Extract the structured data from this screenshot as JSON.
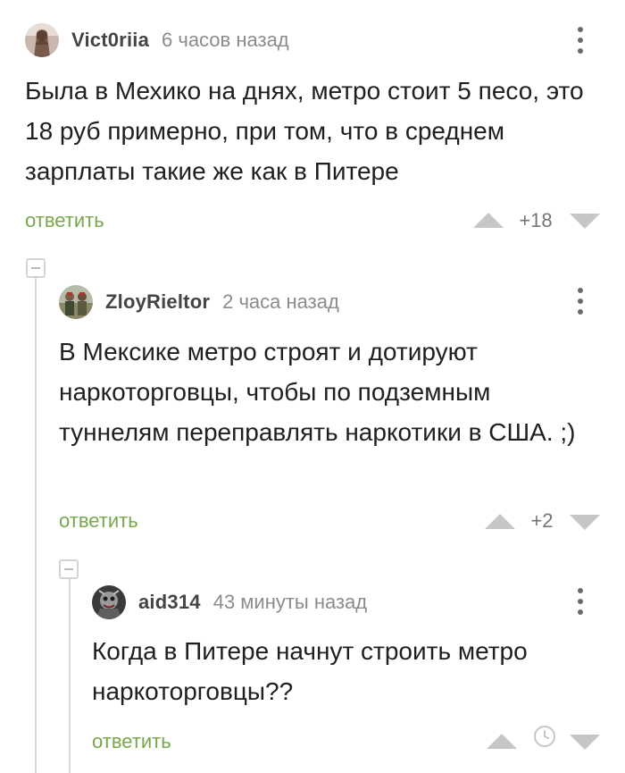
{
  "comments": [
    {
      "author": "Vict0riia",
      "time": "6 часов назад",
      "text": "Была в Мехико на днях, метро стоит 5 песо, это 18 руб примерно, при том, что в среднем зарплаты такие же как в Питере",
      "reply_label": "ответить",
      "score": "+18"
    },
    {
      "author": "ZloyRieltor",
      "time": "2 часа назад",
      "text": "В Мексике метро строят и дотируют наркоторговцы, чтобы по подземным туннелям переправлять наркотики в США. ;)",
      "reply_label": "ответить",
      "score": "+2"
    },
    {
      "author": "aid314",
      "time": "43 минуты назад",
      "text": "Когда в Питере начнут строить метро наркоторговцы??",
      "reply_label": "ответить",
      "score_icon": "clock-icon"
    }
  ],
  "colors": {
    "reply_green": "#78a84a",
    "vote_gray": "#c6c6c6",
    "thread_line": "#dadada"
  }
}
